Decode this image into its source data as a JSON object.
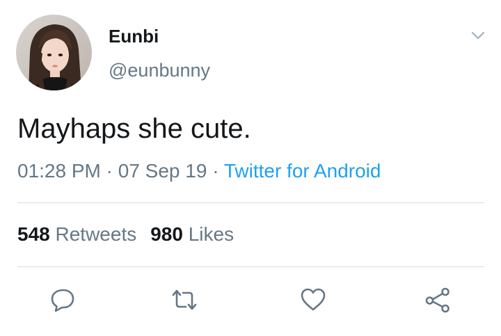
{
  "tweet": {
    "author": {
      "display_name": "Eunbi",
      "handle": "@eunbunny",
      "avatar": "profile-photo"
    },
    "text": "Mayhaps she cute.",
    "time": "01:28 PM",
    "date": "07 Sep 19",
    "separator": " · ",
    "source": "Twitter for Android",
    "stats": {
      "retweets_count": "548",
      "retweets_label": "Retweets",
      "likes_count": "980",
      "likes_label": "Likes"
    },
    "actions": [
      {
        "name": "reply",
        "icon": "speech-bubble-icon"
      },
      {
        "name": "retweet",
        "icon": "retweet-arrows-icon"
      },
      {
        "name": "like",
        "icon": "heart-icon"
      },
      {
        "name": "share",
        "icon": "share-nodes-icon"
      }
    ],
    "menu_icon": "chevron-down-icon"
  },
  "colors": {
    "text": "#14171a",
    "secondary": "#657786",
    "link": "#1da1f2",
    "divider": "#d4dbe0"
  }
}
